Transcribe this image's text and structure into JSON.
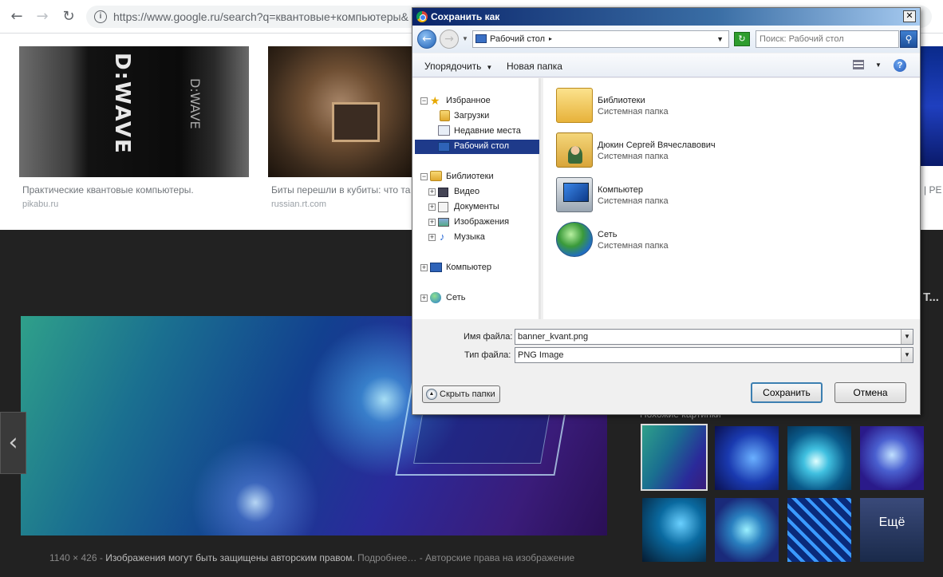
{
  "browser": {
    "url": "https://www.google.ru/search?q=квантовые+компьютеры&",
    "back_icon": "←",
    "forward_icon": "→",
    "reload_icon": "↻",
    "info_icon": "i"
  },
  "results": [
    {
      "title": "Практические квантовые компьютеры.",
      "source": "pikabu.ru",
      "logo": "D:WAVE"
    },
    {
      "title": "Биты перешли в кубиты: что та",
      "source": "russian.rt.com"
    }
  ],
  "right_edge": {
    "text": "| PE",
    "title_fragment": "Т..."
  },
  "preview": {
    "prev_arrow": "‹",
    "caption_size": "1140 × 426",
    "caption_sep": " - ",
    "caption_warning": "Изображения могут быть защищены авторским правом.",
    "caption_more": " Подробнее…",
    "caption_rights": " - Авторские права на изображение"
  },
  "related": {
    "title": "Похожие картинки",
    "more_label": "Ещё"
  },
  "dialog": {
    "title": "Сохранить как",
    "close_icon": "✕",
    "address": "Рабочий стол",
    "search_placeholder": "Поиск: Рабочий стол",
    "search_icon": "⚲",
    "toolbar": {
      "organize": "Упорядочить",
      "new_folder": "Новая папка",
      "help": "?"
    },
    "tree": {
      "favorites": "Избранное",
      "downloads": "Загрузки",
      "recent": "Недавние места",
      "desktop": "Рабочий стол",
      "libraries": "Библиотеки",
      "video": "Видео",
      "documents": "Документы",
      "images": "Изображения",
      "music": "Музыка",
      "computer": "Компьютер",
      "network": "Сеть"
    },
    "files": [
      {
        "name": "Библиотеки",
        "type": "Системная папка"
      },
      {
        "name": "Дюкин Сергей Вячеславович",
        "type": "Системная папка"
      },
      {
        "name": "Компьютер",
        "type": "Системная папка"
      },
      {
        "name": "Сеть",
        "type": "Системная папка"
      }
    ],
    "filename_label": "Имя файла:",
    "filename_value": "banner_kvant.png",
    "filetype_label": "Тип файла:",
    "filetype_value": "PNG Image",
    "hide_folders": "Скрыть папки",
    "save": "Сохранить",
    "cancel": "Отмена"
  }
}
